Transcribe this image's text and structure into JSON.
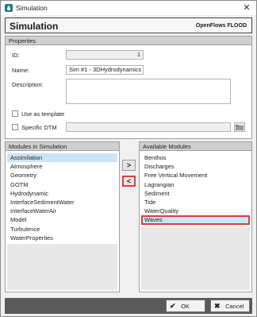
{
  "window": {
    "title": "Simulation",
    "title_icon": "droplet-icon",
    "close_glyph": "✕"
  },
  "header": {
    "title": "Simulation",
    "brand": "OpenFlows FLOOD"
  },
  "properties": {
    "heading": "Properties",
    "id_label": "ID:",
    "id_value": "1",
    "name_label": "Name:",
    "name_value": "Sim #1 - 3DHydrodynamics -",
    "description_label": "Description:",
    "description_value": "",
    "use_as_template_label": "Use as template",
    "use_as_template_checked": false,
    "specific_dtm_label": "Specific DTM",
    "specific_dtm_checked": false,
    "dtm_path_value": ""
  },
  "modules_in_simulation": {
    "heading": "Modules in Simulation",
    "items": [
      "Assimilation",
      "Atmosphere",
      "Geometry",
      "GOTM",
      "Hydrodynamic",
      "InterfaceSedimentWater",
      "InterfaceWaterAir",
      "Model",
      "Turbulence",
      "WaterProperties"
    ],
    "selected": "Assimilation"
  },
  "available_modules": {
    "heading": "Available Modules",
    "items": [
      "Benthos",
      "Discharges",
      "Free Vertical Movement",
      "Lagrangian",
      "Sediment",
      "Tide",
      "WaterQuality",
      "Waves"
    ],
    "selected": "Waves"
  },
  "transfer": {
    "add_glyph": ">",
    "remove_glyph": "<"
  },
  "footer": {
    "ok_label": "OK",
    "cancel_label": "Cancel",
    "ok_glyph": "✔",
    "cancel_glyph": "✖"
  },
  "colors": {
    "highlight_border": "#e03c3c",
    "selection": "#cce4f7",
    "header_bar": "#5a5a5a"
  }
}
